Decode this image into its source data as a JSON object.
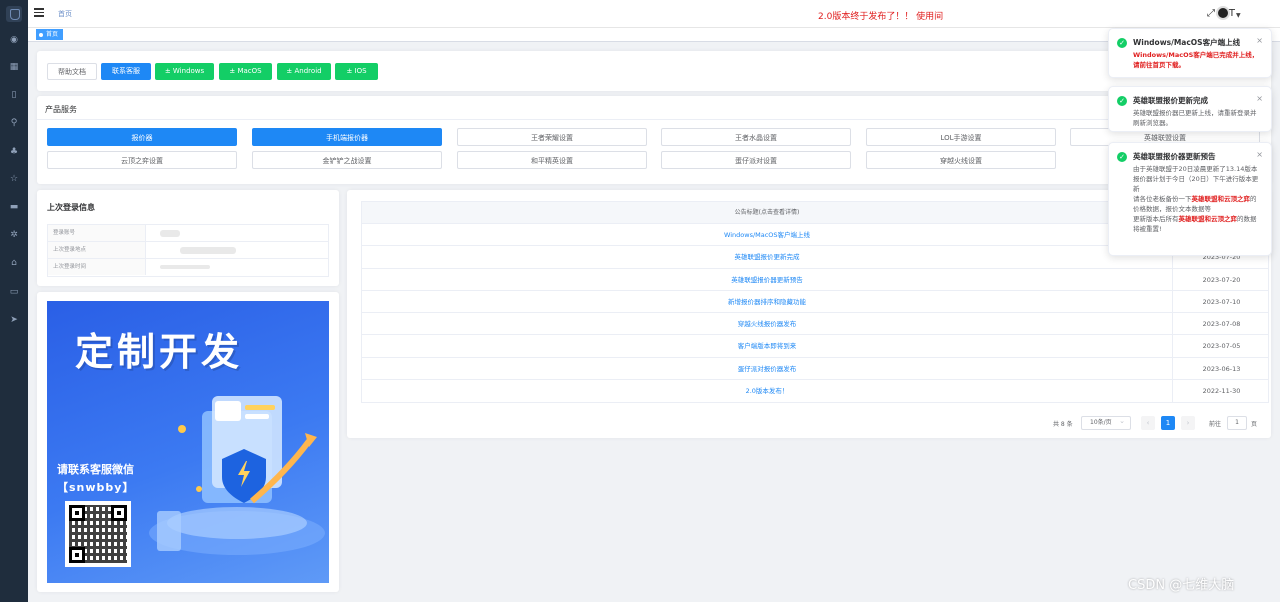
{
  "sidebar": {
    "icons": [
      "dashboard-icon",
      "grid-icon",
      "phone-icon",
      "search-icon",
      "sitemap-icon",
      "star-icon",
      "message-icon",
      "gear-icon",
      "lock-icon",
      "monitor-icon",
      "send-icon"
    ]
  },
  "topbar": {
    "breadcrumb": "首页",
    "announcement": "2.0版本终于发布了！！ 使用间"
  },
  "tags": {
    "active": "首页"
  },
  "toolbar": {
    "help": "帮助文档",
    "service": "联系客服",
    "windows": "± Windows",
    "macos": "± MacOS",
    "android": "± Android",
    "ios": "± IOS"
  },
  "products": {
    "title": "产品服务",
    "row1": [
      "报价器",
      "手机端报价器",
      "王者荣耀设置",
      "王者水晶设置",
      "LOL手游设置",
      "英雄联盟设置"
    ],
    "row2": [
      "云顶之弈设置",
      "金铲铲之战设置",
      "和平精英设置",
      "蛋仔派对设置",
      "穿越火线设置"
    ]
  },
  "login_info": {
    "title": "上次登录信息",
    "labels": [
      "登录账号",
      "上次登录地点",
      "上次登录时间"
    ]
  },
  "promo": {
    "title": "定制开发",
    "contact": "请联系客服微信",
    "wechat": "【snwbby】"
  },
  "announcements": {
    "header_title": "公告标题(点击查看详情)",
    "rows": [
      {
        "title": "Windows/MacOS客户端上线",
        "date": ""
      },
      {
        "title": "英雄联盟报价更新完成",
        "date": "2023-07-20"
      },
      {
        "title": "英雄联盟报价器更新预告",
        "date": "2023-07-20"
      },
      {
        "title": "新增报价器排序和隐藏功能",
        "date": "2023-07-10"
      },
      {
        "title": "穿越火线报价器发布",
        "date": "2023-07-08"
      },
      {
        "title": "客户端版本即将到来",
        "date": "2023-07-05"
      },
      {
        "title": "蛋仔派对报价器发布",
        "date": "2023-06-13"
      },
      {
        "title": "2.0版本发布！",
        "date": "2022-11-30"
      }
    ]
  },
  "pagination": {
    "total": "共 8 条",
    "page_size": "10条/页",
    "prev": "‹",
    "current": "1",
    "next": "›",
    "goto": "前往",
    "goto_value": "1",
    "page_unit": "页"
  },
  "notifications": [
    {
      "title": "Windows/MacOS客户端上线",
      "body": "Windows/MacOS客户端已完成并上线，请前往首页下载。"
    },
    {
      "title": "英雄联盟报价更新完成",
      "body": "英雄联盟报价器已更新上线，请重新登录并刷新浏览器。"
    },
    {
      "title": "英雄联盟报价器更新预告",
      "body1": "由于英雄联盟于20日凌晨更新了13.14版本",
      "body2": "报价器计划于今日（20日）下午进行版本更新",
      "body3a": "请各位老板备份一下",
      "body3b": "英雄联盟和云顶之弈",
      "body3c": "的价格数据，报价文本数据等",
      "body4a": "更新版本后所有",
      "body4b": "英雄联盟和云顶之弈",
      "body4c": "的数据将被重置!"
    }
  ],
  "watermark": "CSDN @七维大脑"
}
